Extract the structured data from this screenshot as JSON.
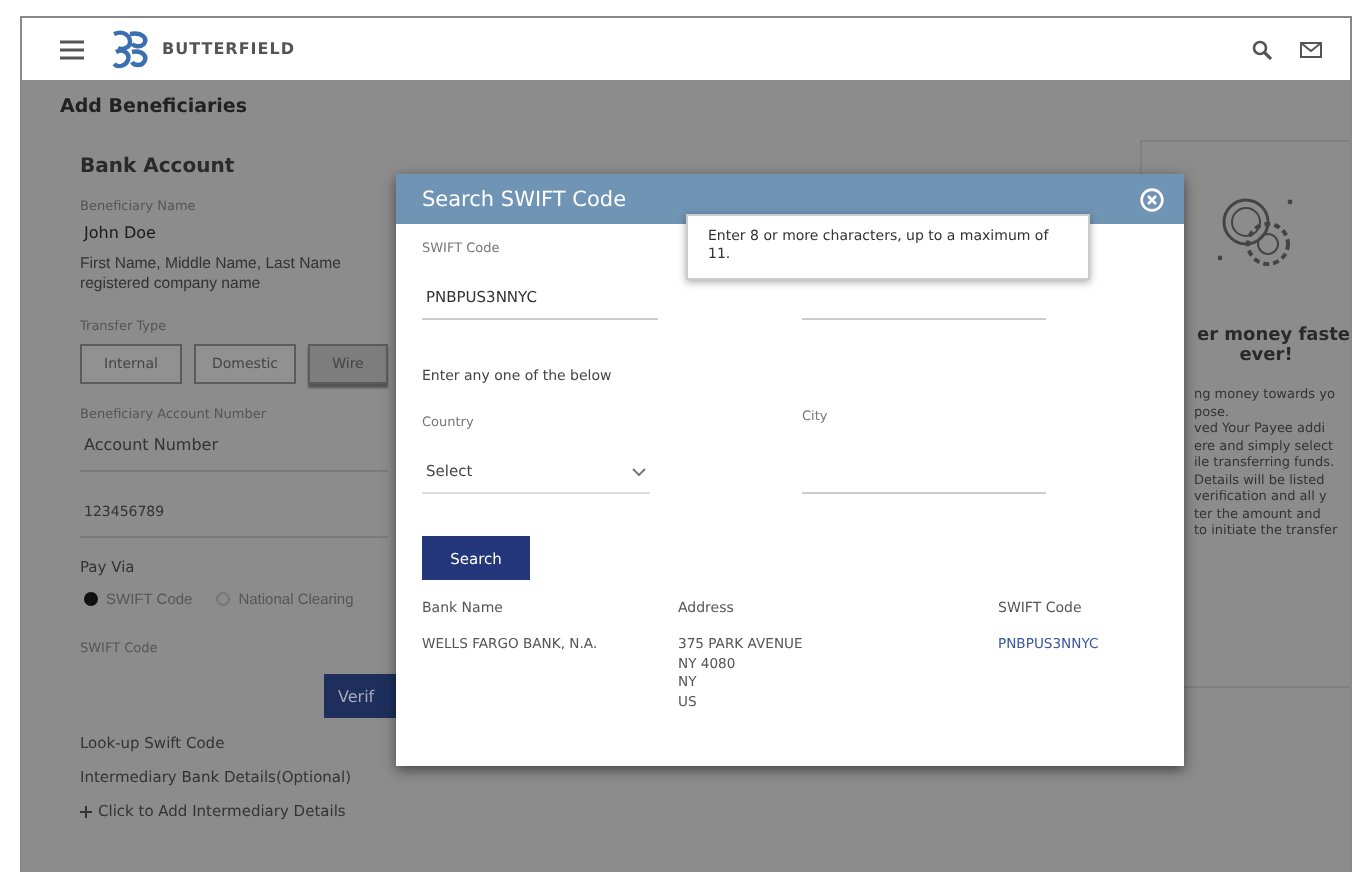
{
  "header": {
    "brand": "BUTTERFIELD"
  },
  "page": {
    "title": "Add Beneficiaries",
    "section": "Bank Account",
    "beneficiary_name": {
      "label": "Beneficiary Name",
      "value": "John Doe",
      "hint": "First Name, Middle Name, Last Name registered company name"
    },
    "transfer_type": {
      "label": "Transfer Type",
      "options": [
        {
          "label": "Internal",
          "selected": false
        },
        {
          "label": "Domestic",
          "selected": false
        },
        {
          "label": "Wire",
          "selected": true
        }
      ]
    },
    "account_number": {
      "label": "Beneficiary Account Number",
      "placeholder": "Account Number",
      "confirm_value": "123456789"
    },
    "pay_via": {
      "label": "Pay Via",
      "options": [
        {
          "label": "SWIFT Code",
          "selected": true
        },
        {
          "label": "National Clearing",
          "selected": false
        }
      ]
    },
    "swift_code": {
      "label": "SWIFT Code",
      "verify_button": "Verif"
    },
    "links": [
      "Look-up Swift Code",
      "Intermediary Bank Details(Optional)",
      "Click to Add Intermediary Details"
    ]
  },
  "promo": {
    "heading": [
      "er money faste",
      "ever!"
    ],
    "lines": [
      "ng money towards yo",
      "pose.",
      "ved Your Payee addi",
      "ere and simply select",
      "ile transferring funds.",
      "Details will be listed",
      "verification and all y",
      "ter the amount and",
      "to initiate the transfer"
    ]
  },
  "modal": {
    "title": "Search SWIFT Code",
    "tooltip": "Enter 8 or more characters, up to a maximum of 11.",
    "swift_code": {
      "label": "SWIFT Code",
      "value": "PNBPUS3NNYC"
    },
    "instruction": "Enter any one of the below",
    "country": {
      "label": "Country",
      "value": "Select"
    },
    "city": {
      "label": "City"
    },
    "search_button": "Search",
    "table": {
      "columns": [
        "Bank Name",
        "Address",
        "SWIFT Code"
      ],
      "rows": [
        {
          "bank_name": "WELLS FARGO BANK, N.A.",
          "address": [
            "375 PARK AVENUE",
            "NY 4080",
            "NY",
            "US"
          ],
          "swift_code": "PNBPUS3NNYC"
        }
      ]
    }
  }
}
